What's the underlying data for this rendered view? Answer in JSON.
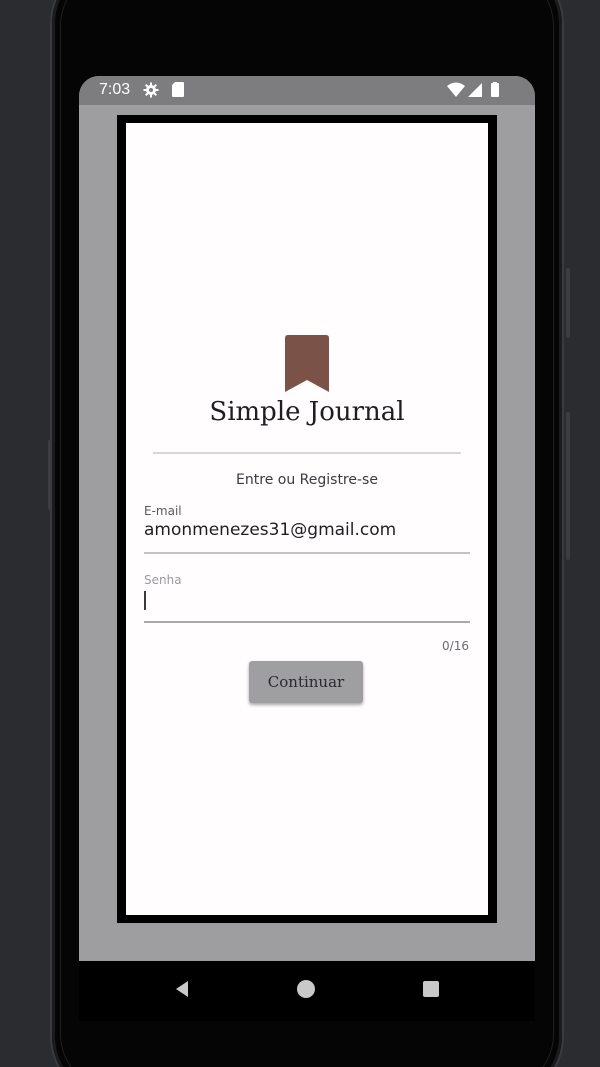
{
  "status_bar": {
    "time": "7:03",
    "left_icons": [
      "gear-icon",
      "sd-card-icon"
    ],
    "right_icons": [
      "wifi-icon",
      "signal-icon",
      "battery-icon"
    ]
  },
  "app": {
    "logo_icon": "bookmark-icon",
    "logo_color": "#7b5248",
    "title": "Simple Journal",
    "subtitle": "Entre ou Registre-se",
    "email": {
      "label": "E-mail",
      "value": "amonmenezes31@gmail.com"
    },
    "password": {
      "label": "Senha",
      "value": "",
      "counter": "0/16"
    },
    "continue_label": "Continuar"
  },
  "nav_bar": {
    "icons": [
      "back-icon",
      "home-icon",
      "recents-icon"
    ]
  }
}
